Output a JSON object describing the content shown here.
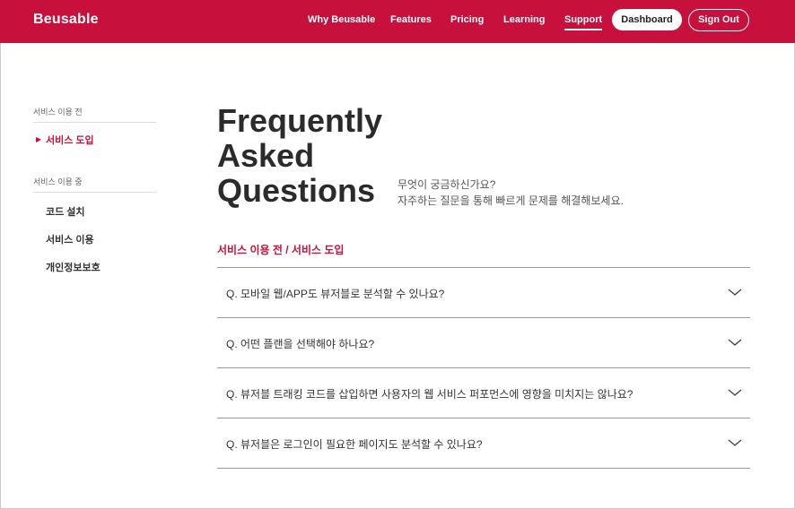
{
  "header": {
    "logo": "Beusable",
    "nav": [
      "Why Beusable",
      "Features",
      "Pricing",
      "Learning",
      "Support"
    ],
    "dashboard_label": "Dashboard",
    "signout_label": "Sign Out",
    "brand_color": "#c8103d"
  },
  "sidebar": {
    "group1_title": "서비스 이용 전",
    "group1_items": [
      "서비스 도입"
    ],
    "group2_title": "서비스 이용 중",
    "group2_items": [
      "코드 설치",
      "서비스 이용",
      "개인정보보호"
    ]
  },
  "main": {
    "title_lines": [
      "Frequently",
      "Asked",
      "Questions"
    ],
    "intro_lines": [
      "무엇이 궁금하신가요?",
      "자주하는 질문을 통해 빠르게 문제를 해결해보세요."
    ],
    "breadcrumb": "서비스 이용 전 / 서비스 도입",
    "faqs": [
      "Q. 모바일 웹/APP도 뷰저블로 분석할 수 있나요?",
      "Q. 어떤 플랜을 선택해야 하나요?",
      "Q. 뷰저블 트래킹 코드를 삽입하면 사용자의 웹 서비스 퍼포먼스에 영향을 미치지는 않나요?",
      "Q. 뷰저블은 로그인이 필요한 페이지도 분석할 수 있나요?"
    ]
  }
}
